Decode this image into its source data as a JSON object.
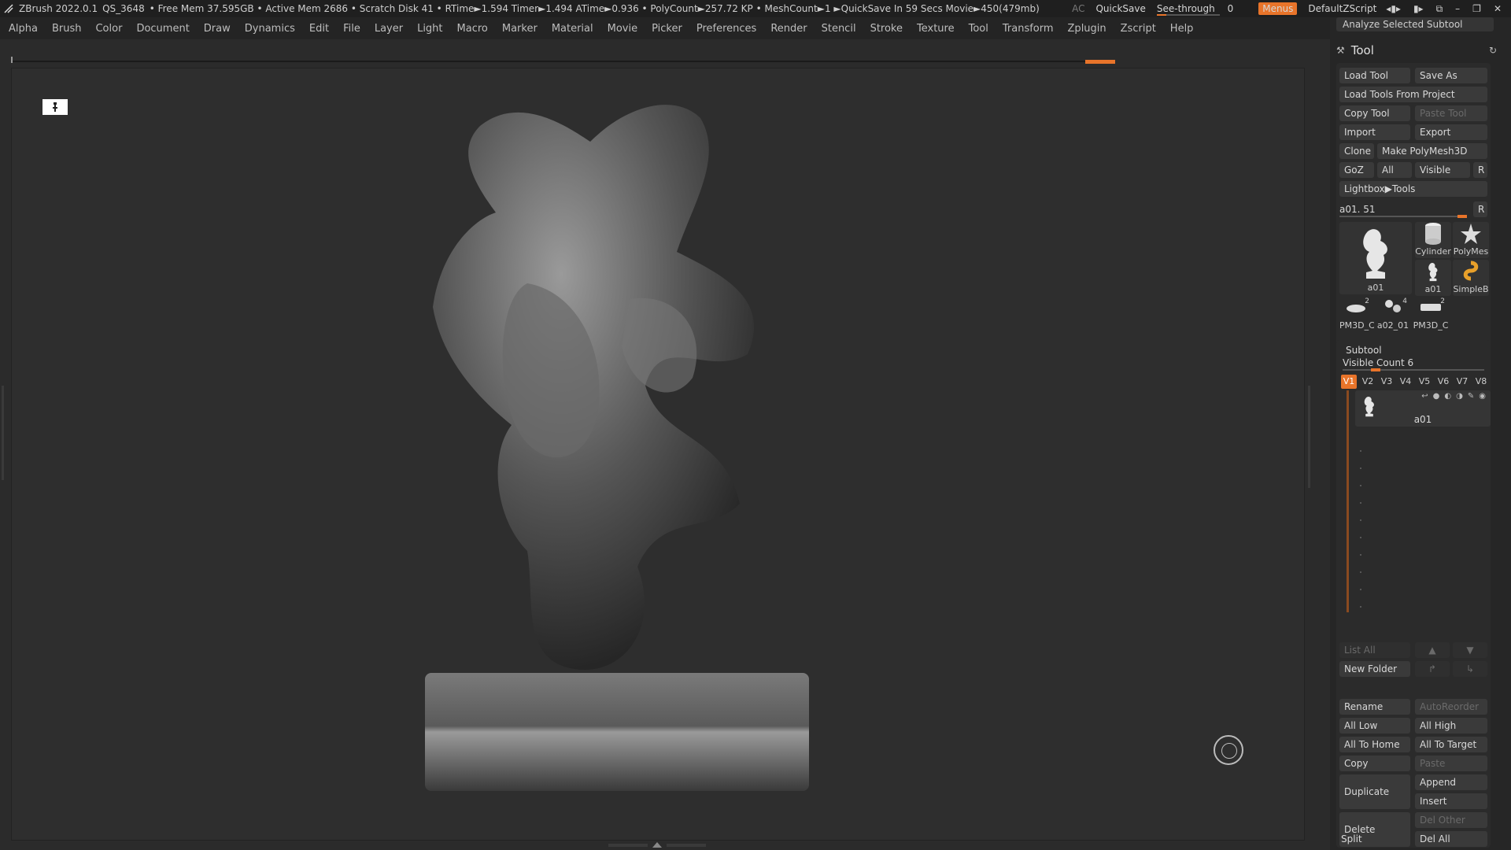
{
  "titlebar": {
    "app": "ZBrush 2022.0.1",
    "project": "QS_3648",
    "stats": "• Free Mem 37.595GB • Active Mem 2686 • Scratch Disk 41 • RTime►1.594 Timer►1.494 ATime►0.936 • PolyCount►257.72 KP • MeshCount►1 ►QuickSave In 59 Secs Movie►450(479mb)",
    "ac": "AC",
    "quicksave": "QuickSave",
    "seethrough": "See-through",
    "seethrough_value": "0",
    "seethrough_level": 0,
    "menus": "Menus",
    "script": "DefaultZScript"
  },
  "menubar": [
    "Alpha",
    "Brush",
    "Color",
    "Document",
    "Draw",
    "Dynamics",
    "Edit",
    "File",
    "Layer",
    "Light",
    "Macro",
    "Marker",
    "Material",
    "Movie",
    "Picker",
    "Preferences",
    "Render",
    "Stencil",
    "Stroke",
    "Texture",
    "Tool",
    "Transform",
    "Zplugin",
    "Zscript",
    "Help"
  ],
  "tray": {
    "analyze": "Analyze Selected Subtool",
    "title": "Tool",
    "buttons": {
      "load_tool": "Load Tool",
      "save_as": "Save As",
      "load_from_project": "Load Tools From Project",
      "copy_tool": "Copy Tool",
      "paste_tool": "Paste Tool",
      "import": "Import",
      "export": "Export",
      "clone": "Clone",
      "make_polymesh": "Make PolyMesh3D",
      "goz": "GoZ",
      "all": "All",
      "visible": "Visible",
      "r": "R",
      "lightbox": "Lightbox▶Tools"
    },
    "tool_slider": {
      "label": "a01. 51",
      "r": "R",
      "level": 0.94
    },
    "thumbs": {
      "main": "a01",
      "cylinder": "Cylinder",
      "polymesh": "PolyMes",
      "a01_small": "a01",
      "simpleb": "SimpleB",
      "pm3d_c1": "PM3D_C",
      "pm3d_c1_count": "2",
      "a02_01": "a02_01",
      "a02_01_count": "4",
      "pm3d_c2": "PM3D_C",
      "pm3d_c2_count": "2"
    },
    "subtool": {
      "title": "Subtool",
      "visible_count": "Visible Count 6",
      "visible_level": 0.2,
      "tabs": [
        "V1",
        "V2",
        "V3",
        "V4",
        "V5",
        "V6",
        "V7",
        "V8"
      ],
      "active_tab": "V1",
      "item_name": "a01",
      "list_all": "List All",
      "new_folder": "New Folder",
      "rename": "Rename",
      "autoreorder": "AutoReorder",
      "all_low": "All Low",
      "all_high": "All High",
      "all_to_home": "All To Home",
      "all_to_target": "All To Target",
      "copy": "Copy",
      "paste": "Paste",
      "duplicate": "Duplicate",
      "append": "Append",
      "insert": "Insert",
      "delete": "Delete",
      "del_other": "Del Other",
      "del_all": "Del All",
      "split": "Split"
    }
  }
}
